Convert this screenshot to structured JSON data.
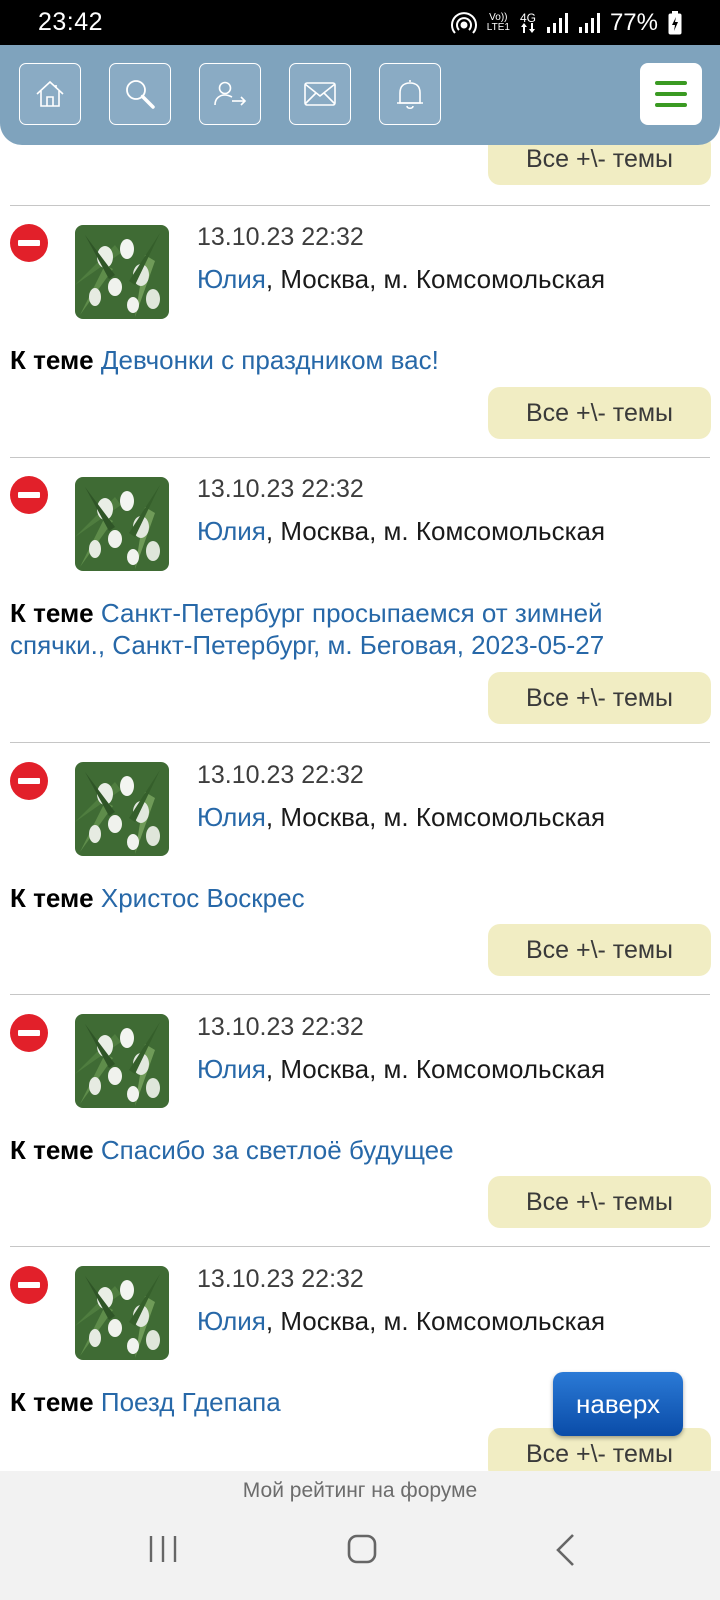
{
  "status_bar": {
    "time": "23:42",
    "network_top": "Vo))",
    "network_bottom": "LTE1",
    "network_type": "4G",
    "battery": "77%"
  },
  "header": {
    "icons": [
      "home-icon",
      "search-icon",
      "user-logout-icon",
      "mail-icon",
      "bell-icon",
      "menu-icon"
    ]
  },
  "common": {
    "all_topics_label": "Все +\\- темы",
    "topic_prefix": "К теме"
  },
  "posts": [
    {
      "date": "13.10.23 22:32",
      "author": "Юлия",
      "location": ", Москва, м. Комсомольская",
      "topic": "Девчонки с праздником вас!"
    },
    {
      "date": "13.10.23 22:32",
      "author": "Юлия",
      "location": ", Москва, м. Комсомольская",
      "topic": "Санкт-Петербург просыпаемся от зимней спячки., Санкт-Петербург, м. Беговая, 2023-05-27"
    },
    {
      "date": "13.10.23 22:32",
      "author": "Юлия",
      "location": ", Москва, м. Комсомольская",
      "topic": "Христос Воскрес"
    },
    {
      "date": "13.10.23 22:32",
      "author": "Юлия",
      "location": ", Москва, м. Комсомольская",
      "topic": "Спасибо за светлоё будущее"
    },
    {
      "date": "13.10.23 22:32",
      "author": "Юлия",
      "location": ", Москва, м. Комсомольская",
      "topic": "Поезд Гдепапа"
    }
  ],
  "to_top_label": "наверх",
  "footer": {
    "rating_label": "Мой рейтинг на форуме"
  },
  "colors": {
    "header_bg": "#7fa3bd",
    "link": "#2768a8",
    "topics_button_bg": "#f1edc3",
    "to_top_button": "#1b63c0",
    "remove_icon": "#e2202a",
    "menu_lines": "#3a9a22"
  }
}
